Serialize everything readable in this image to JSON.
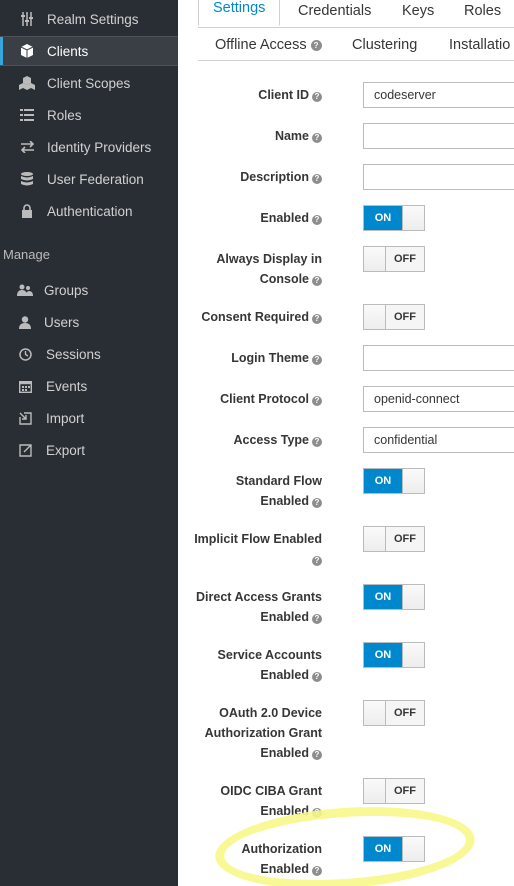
{
  "sidebar": {
    "items": [
      {
        "label": "Realm Settings",
        "icon": "sliders-icon",
        "active": false
      },
      {
        "label": "Clients",
        "icon": "cube-icon",
        "active": true
      },
      {
        "label": "Client Scopes",
        "icon": "cubes-icon",
        "active": false
      },
      {
        "label": "Roles",
        "icon": "list-icon",
        "active": false
      },
      {
        "label": "Identity Providers",
        "icon": "exchange-icon",
        "active": false
      },
      {
        "label": "User Federation",
        "icon": "database-icon",
        "active": false
      },
      {
        "label": "Authentication",
        "icon": "lock-icon",
        "active": false
      }
    ],
    "manage_label": "Manage",
    "manage_items": [
      {
        "label": "Groups",
        "icon": "users-icon"
      },
      {
        "label": "Users",
        "icon": "user-icon"
      },
      {
        "label": "Sessions",
        "icon": "clock-icon"
      },
      {
        "label": "Events",
        "icon": "calendar-icon"
      },
      {
        "label": "Import",
        "icon": "import-icon"
      },
      {
        "label": "Export",
        "icon": "export-icon"
      }
    ]
  },
  "tabs": {
    "row1": [
      "Settings",
      "Credentials",
      "Keys",
      "Roles"
    ],
    "row2": [
      "Offline Access",
      "Clustering",
      "Installatio"
    ]
  },
  "form": {
    "client_id": {
      "label": "Client ID",
      "value": "codeserver"
    },
    "name": {
      "label": "Name",
      "value": ""
    },
    "description": {
      "label": "Description",
      "value": ""
    },
    "enabled": {
      "label": "Enabled",
      "state": "ON"
    },
    "always_display": {
      "label1": "Always Display in",
      "label2": "Console",
      "state": "OFF"
    },
    "consent_required": {
      "label": "Consent Required",
      "state": "OFF"
    },
    "login_theme": {
      "label": "Login Theme",
      "value": ""
    },
    "client_protocol": {
      "label": "Client Protocol",
      "value": "openid-connect"
    },
    "access_type": {
      "label": "Access Type",
      "value": "confidential"
    },
    "standard_flow": {
      "label1": "Standard Flow",
      "label2": "Enabled",
      "state": "ON"
    },
    "implicit_flow": {
      "label1": "Implicit Flow Enabled",
      "state": "OFF"
    },
    "direct_access": {
      "label1": "Direct Access Grants",
      "label2": "Enabled",
      "state": "ON"
    },
    "service_accounts": {
      "label1": "Service Accounts",
      "label2": "Enabled",
      "state": "ON"
    },
    "oauth_device": {
      "label1": "OAuth 2.0 Device",
      "label2": "Authorization Grant",
      "label3": "Enabled",
      "state": "OFF"
    },
    "oidc_ciba": {
      "label1": "OIDC CIBA Grant",
      "label2": "Enabled",
      "state": "OFF"
    },
    "authorization": {
      "label1": "Authorization",
      "label2": "Enabled",
      "state": "ON"
    }
  },
  "colors": {
    "accent": "#0088ce",
    "sidebar_bg": "#292e34",
    "highlight": "#f7f78a"
  }
}
